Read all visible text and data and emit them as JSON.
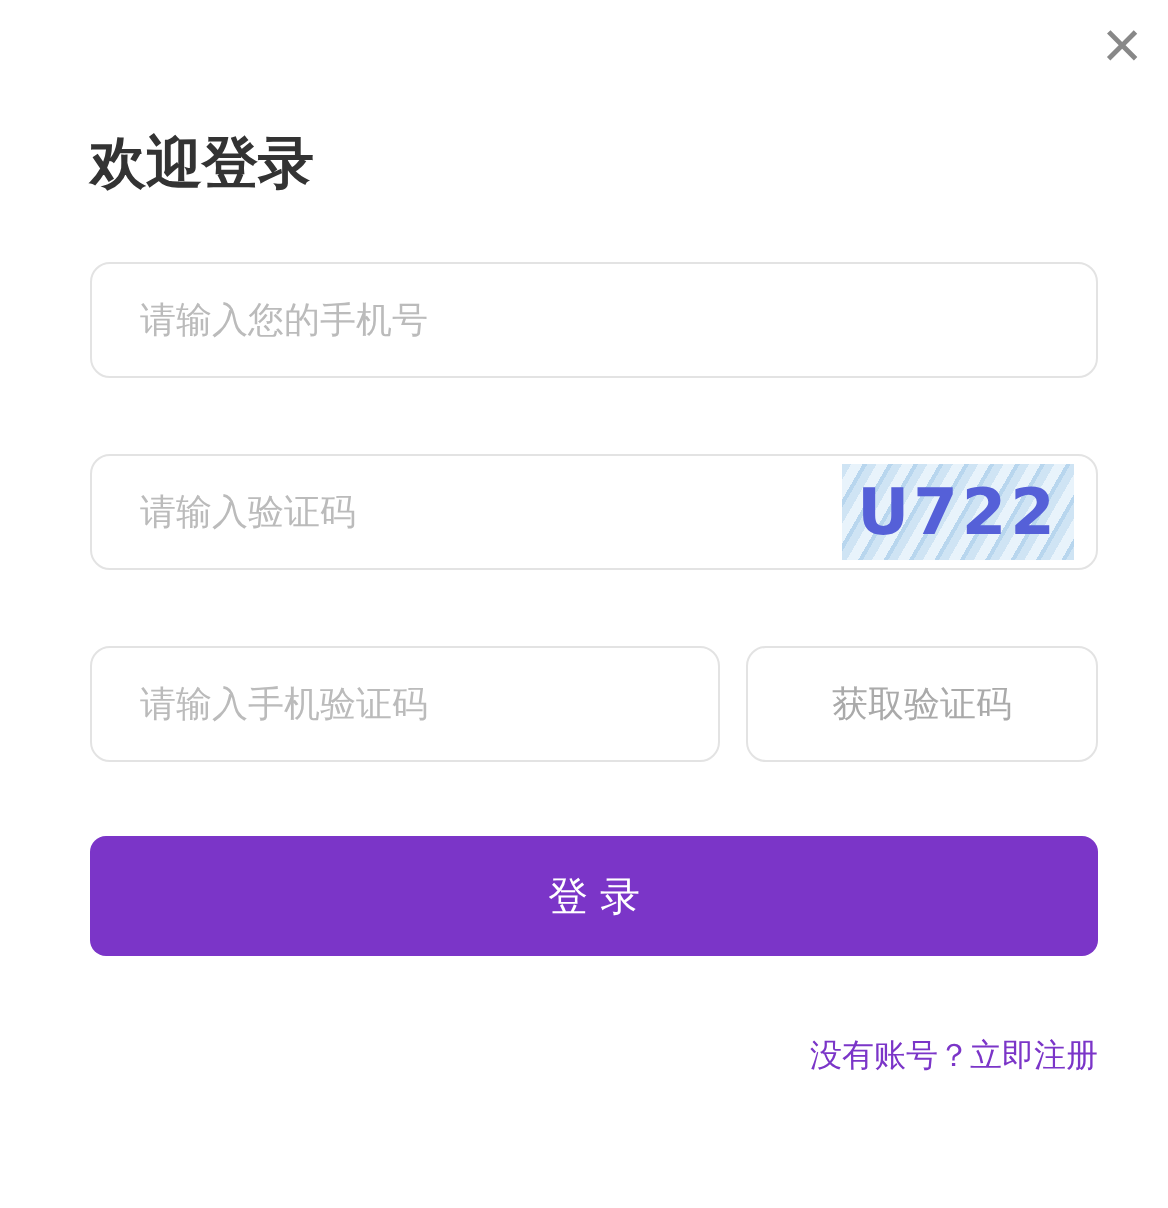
{
  "close": {
    "symbol": "×"
  },
  "title": "欢迎登录",
  "phone_field": {
    "placeholder": "请输入您的手机号"
  },
  "captcha_field": {
    "placeholder": "请输入验证码",
    "captcha": "U722"
  },
  "sms_field": {
    "placeholder": "请输入手机验证码"
  },
  "get_code_button": "获取验证码",
  "login_button": "登 录",
  "register_link": "没有账号？立即注册"
}
